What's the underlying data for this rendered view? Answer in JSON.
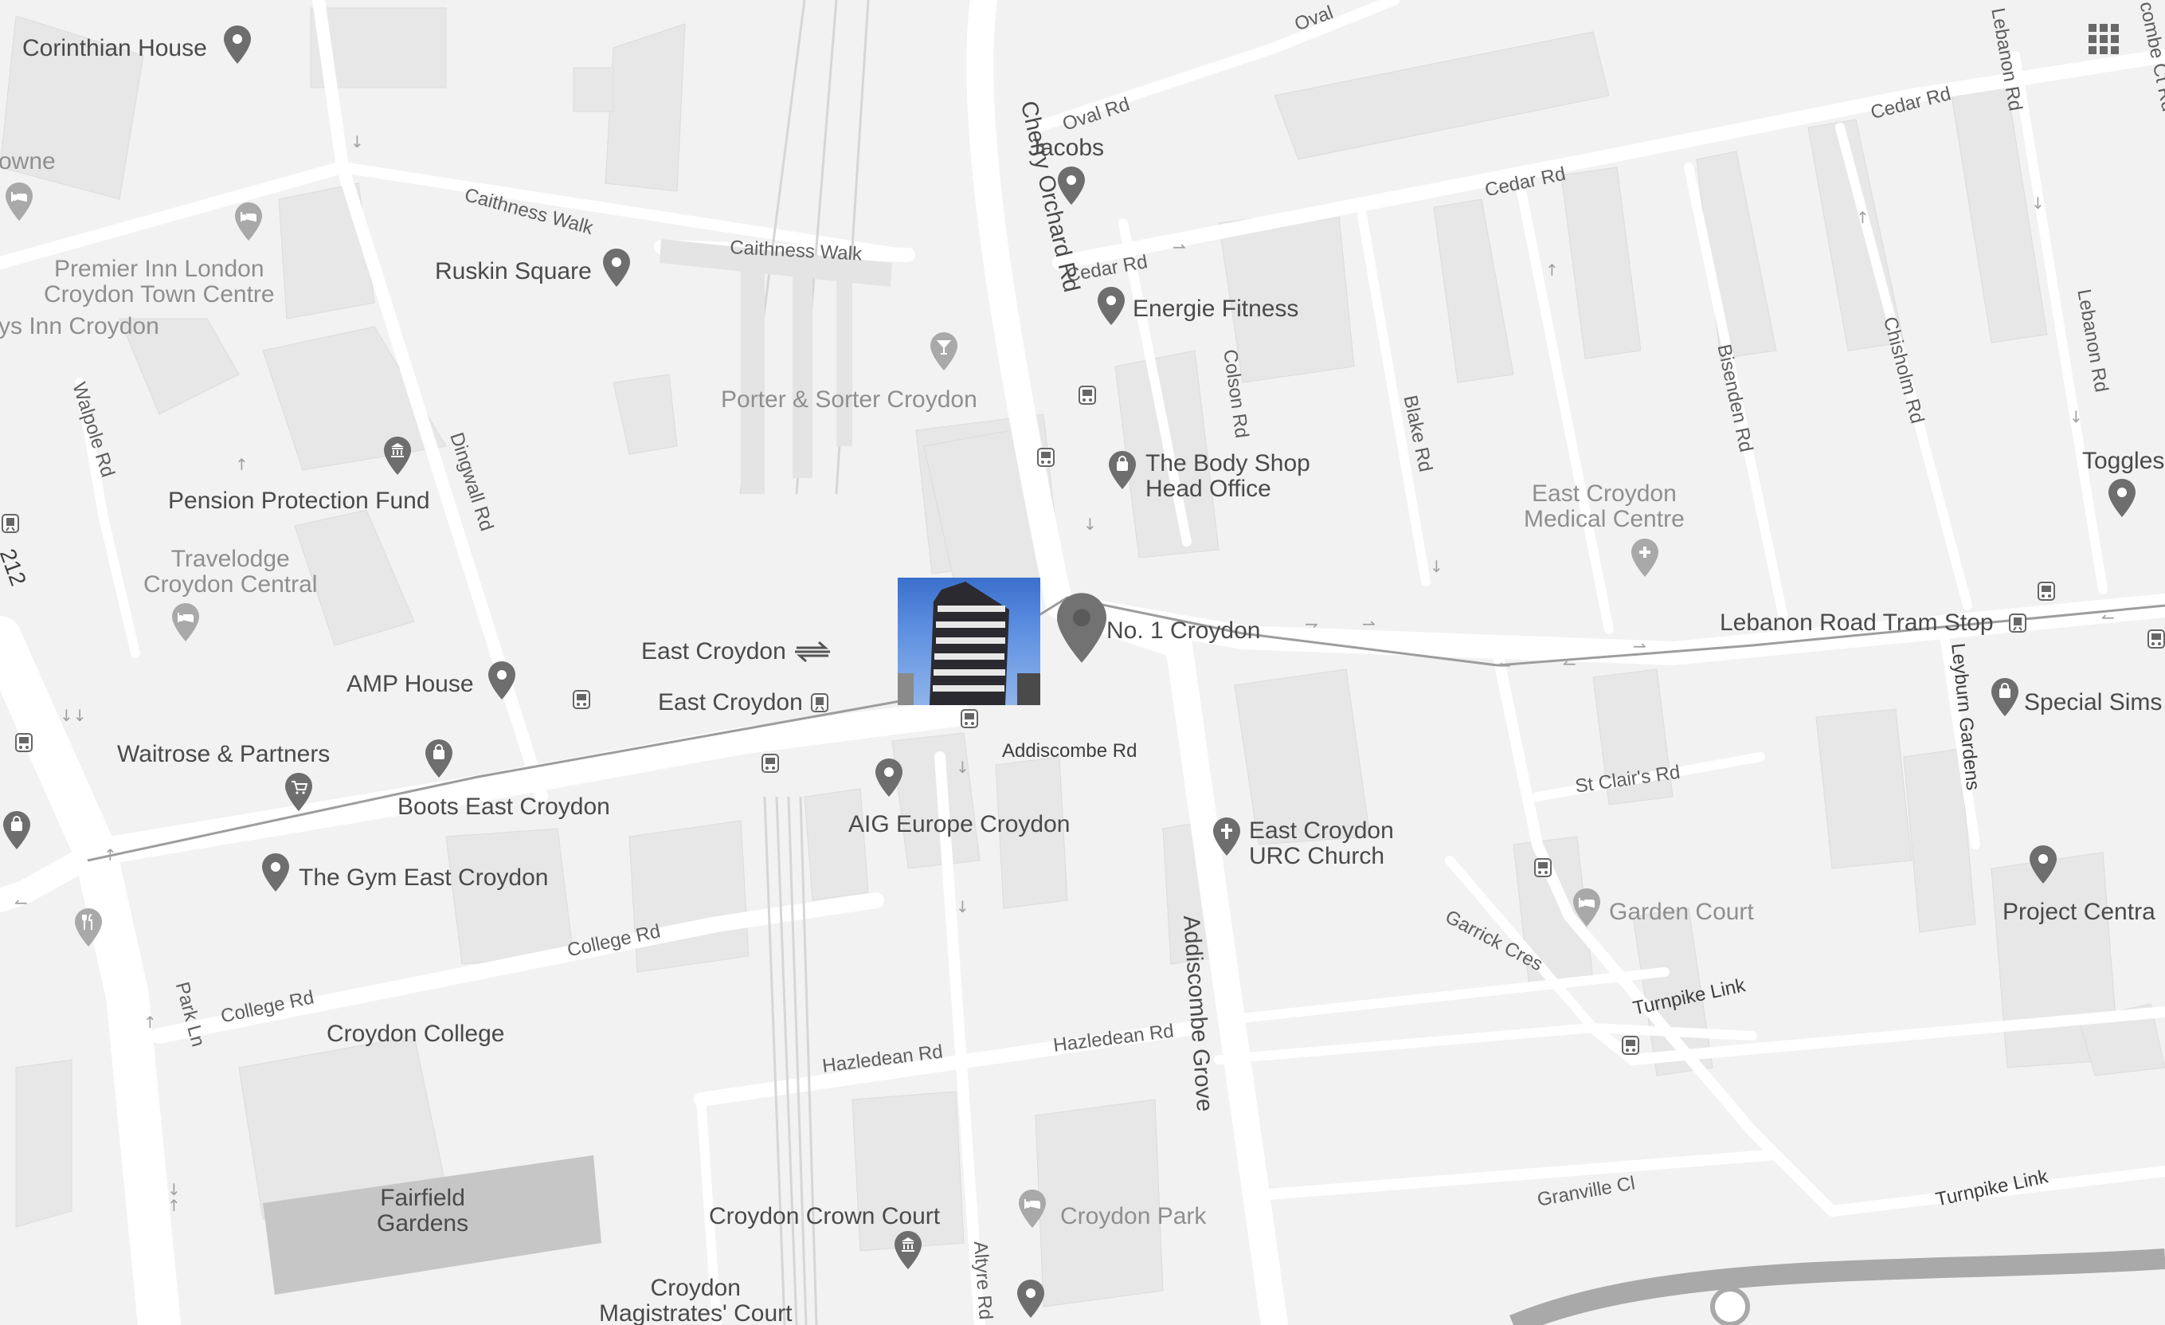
{
  "colors": {
    "land": "#f2f2f2",
    "road": "#ffffff",
    "building": "#e6e6e6",
    "park": "#c6c6c6",
    "marker": "#6e6e6e",
    "label": "#4a4a4a",
    "label_light": "#8f8f8f",
    "tram_line": "#9d9d9d"
  },
  "selected_place": {
    "label": "No. 1 Croydon",
    "icon": "location-pin-icon"
  },
  "pois": {
    "corinthian_house": "Corinthian House",
    "towne": "owne",
    "ruskin_square": "Ruskin Square",
    "premier_inn_1": "Premier Inn London",
    "premier_inn_2": "Croydon Town Centre",
    "days_inn": "ys Inn Croydon",
    "jacobs": "Jacobs",
    "energie_fitness": "Energie Fitness",
    "porter_sorter": "Porter & Sorter Croydon",
    "body_shop_1": "The Body Shop",
    "body_shop_2": "Head Office",
    "pension_protection_fund": "Pension Protection Fund",
    "travelodge_1": "Travelodge",
    "travelodge_2": "Croydon Central",
    "east_croydon_medical_1": "East Croydon",
    "east_croydon_medical_2": "Medical Centre",
    "toggles": "Toggles",
    "east_croydon_rail": "East Croydon",
    "east_croydon_tram": "East Croydon",
    "lebanon_road_tram_stop": "Lebanon Road Tram Stop",
    "amp_house": "AMP House",
    "waitrose": "Waitrose & Partners",
    "boots": "Boots East Croydon",
    "special_sims": "Special Sims",
    "aig_europe": "AIG Europe Croydon",
    "urc_church_1": "East Croydon",
    "urc_church_2": "URC Church",
    "the_gym": "The Gym East Croydon",
    "garden_court": "Garden Court",
    "project_centra": "Project Centra",
    "croydon_college": "Croydon College",
    "fairfield_gardens_1": "Fairfield",
    "fairfield_gardens_2": "Gardens",
    "croydon_crown_court": "Croydon Crown Court",
    "croydon_park": "Croydon Park",
    "magistrates_1": "Croydon",
    "magistrates_2": "Magistrates' Court"
  },
  "streets": {
    "oval_rd_1": "Oval Rd",
    "oval_rd_2": "Oval",
    "cedar_rd_1": "Cedar Rd",
    "cedar_rd_2": "Cedar Rd",
    "cedar_rd_3": "Cedar Rd",
    "lebanon_rd_1": "Lebanon Rd",
    "lebanon_rd_2": "Lebanon Rd",
    "combe_ct_rd": "combe Ct Rd",
    "cherry_orchard_rd": "Cherry Orchard Rd",
    "caithness_walk_1": "Caithness Walk",
    "caithness_walk_2": "Caithness Walk",
    "colson_rd": "Colson Rd",
    "blake_rd": "Blake Rd",
    "bisenden_rd": "Bisenden Rd",
    "chisholm_rd": "Chisholm Rd",
    "walpole_rd": "Walpole Rd",
    "dingwall_rd": "Dingwall Rd",
    "a212": "212",
    "addiscombe_rd": "Addiscombe Rd",
    "st_clairs_rd": "St Clair's Rd",
    "leyburn_gardens": "Leyburn Gardens",
    "garrick_cres": "Garrick Cres",
    "addiscombe_grove": "Addiscombe Grove",
    "turnpike_link_1": "Turnpike Link",
    "turnpike_link_2": "Turnpike Link",
    "college_rd_1": "College Rd",
    "college_rd_2": "College Rd",
    "park_ln": "Park Ln",
    "hazledean_rd_1": "Hazledean Rd",
    "hazledean_rd_2": "Hazledean Rd",
    "granville_cl": "Granville Cl",
    "altyre_rd": "Altyre Rd"
  },
  "controls": {
    "apps_button_icon": "apps-grid-icon"
  }
}
